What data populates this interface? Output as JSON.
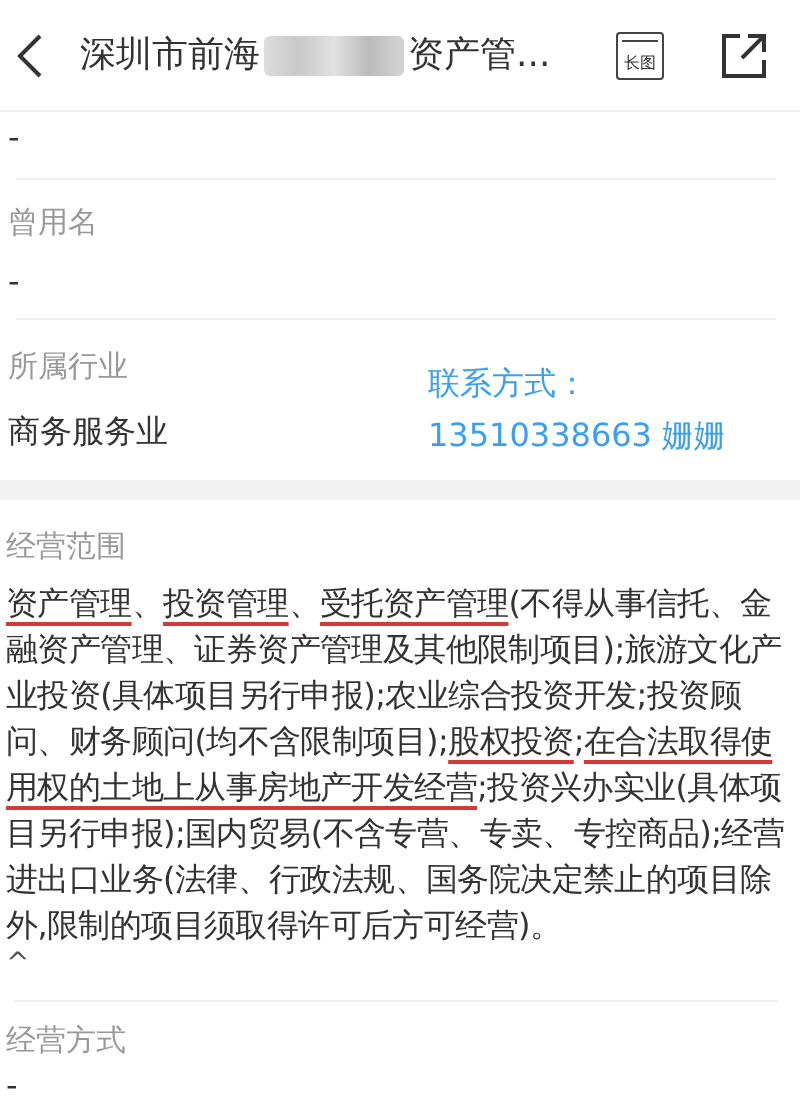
{
  "header": {
    "title_start": "深圳市前海",
    "title_hidden": true,
    "title_end": "资产管...",
    "long_image_label": "长图"
  },
  "top_value": "-",
  "former_name": {
    "label": "曾用名",
    "value": "-"
  },
  "industry": {
    "label": "所属行业",
    "value": "商务服务业",
    "contact_label": "联系方式：",
    "contact_value": "13510338663 姗姗"
  },
  "scope": {
    "label": "经营范围",
    "segments": [
      {
        "text": "资产管理",
        "underlined": true
      },
      {
        "text": "、",
        "underlined": false
      },
      {
        "text": "投资管理",
        "underlined": true
      },
      {
        "text": "、",
        "underlined": false
      },
      {
        "text": "受托资产管理",
        "underlined": true
      },
      {
        "text": "(不得从事信托、金融资产管理、证券资产管理及其他限制项目);旅游文化产业投资(具体项目另行申报);农业综合投资开发;投资顾问、财务顾问(均不含限制项目);",
        "underlined": false
      },
      {
        "text": "股权投资",
        "underlined": true
      },
      {
        "text": ";",
        "underlined": false
      },
      {
        "text": "在合法取得使用权的土地上从事房地产开发经营",
        "underlined": true
      },
      {
        "text": ";投资兴办实业(具体项目另行申报);国内贸易(不含专营、专卖、专控商品);经营进出口业务(法律、行政法规、国务院决定禁止的项目除外,限制的项目须取得许可后方可经营)。",
        "underlined": false
      }
    ],
    "collapse_toggle": "^"
  },
  "business_mode": {
    "label": "经营方式",
    "value": "-"
  }
}
